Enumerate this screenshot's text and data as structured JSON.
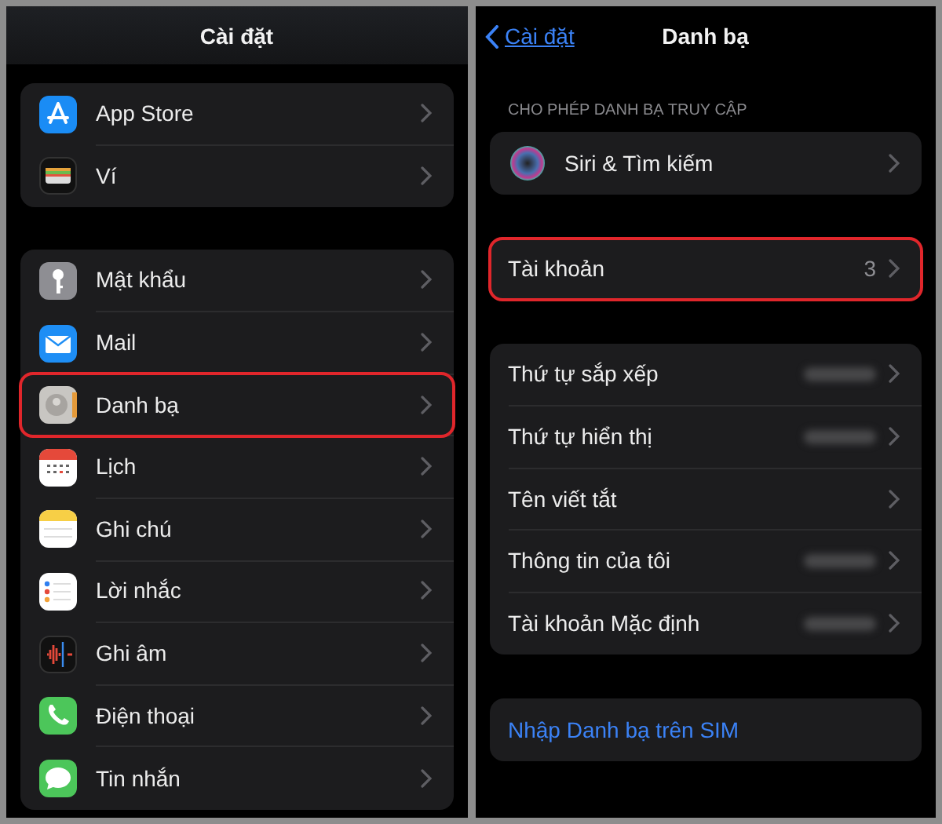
{
  "left_screen": {
    "title": "Cài đặt",
    "groups": [
      {
        "items": [
          {
            "label": "App Store",
            "highlighted": false
          },
          {
            "label": "Ví",
            "highlighted": false
          }
        ]
      },
      {
        "items": [
          {
            "label": "Mật khẩu",
            "highlighted": false
          },
          {
            "label": "Mail",
            "highlighted": false
          },
          {
            "label": "Danh bạ",
            "highlighted": true
          },
          {
            "label": "Lịch",
            "highlighted": false
          },
          {
            "label": "Ghi chú",
            "highlighted": false
          },
          {
            "label": "Lời nhắc",
            "highlighted": false
          },
          {
            "label": "Ghi âm",
            "highlighted": false
          },
          {
            "label": "Điện thoại",
            "highlighted": false
          },
          {
            "label": "Tin nhắn",
            "highlighted": false
          }
        ]
      }
    ]
  },
  "right_screen": {
    "back_link": "Cài đặt",
    "title": "Danh bạ",
    "section_header": "CHO PHÉP DANH BẠ TRUY CẬP",
    "groups": [
      {
        "items": [
          {
            "label": "Siri & Tìm kiếm",
            "kind": "siri",
            "highlighted": false,
            "blurred_value": false
          }
        ]
      },
      {
        "items": [
          {
            "label": "Tài khoản",
            "value": "3",
            "kind": "plain",
            "highlighted": true,
            "blurred_value": false
          }
        ]
      },
      {
        "items": [
          {
            "label": "Thứ tự sắp xếp",
            "kind": "plain",
            "highlighted": false,
            "blurred_value": true
          },
          {
            "label": "Thứ tự hiển thị",
            "kind": "plain",
            "highlighted": false,
            "blurred_value": true
          },
          {
            "label": "Tên viết tắt",
            "kind": "plain",
            "highlighted": false,
            "blurred_value": false
          },
          {
            "label": "Thông tin của tôi",
            "kind": "plain",
            "highlighted": false,
            "blurred_value": true
          },
          {
            "label": "Tài khoản Mặc định",
            "kind": "plain",
            "highlighted": false,
            "blurred_value": true
          }
        ]
      },
      {
        "items": [
          {
            "label": "Nhập Danh bạ trên SIM",
            "kind": "action",
            "highlighted": false
          }
        ]
      }
    ]
  }
}
